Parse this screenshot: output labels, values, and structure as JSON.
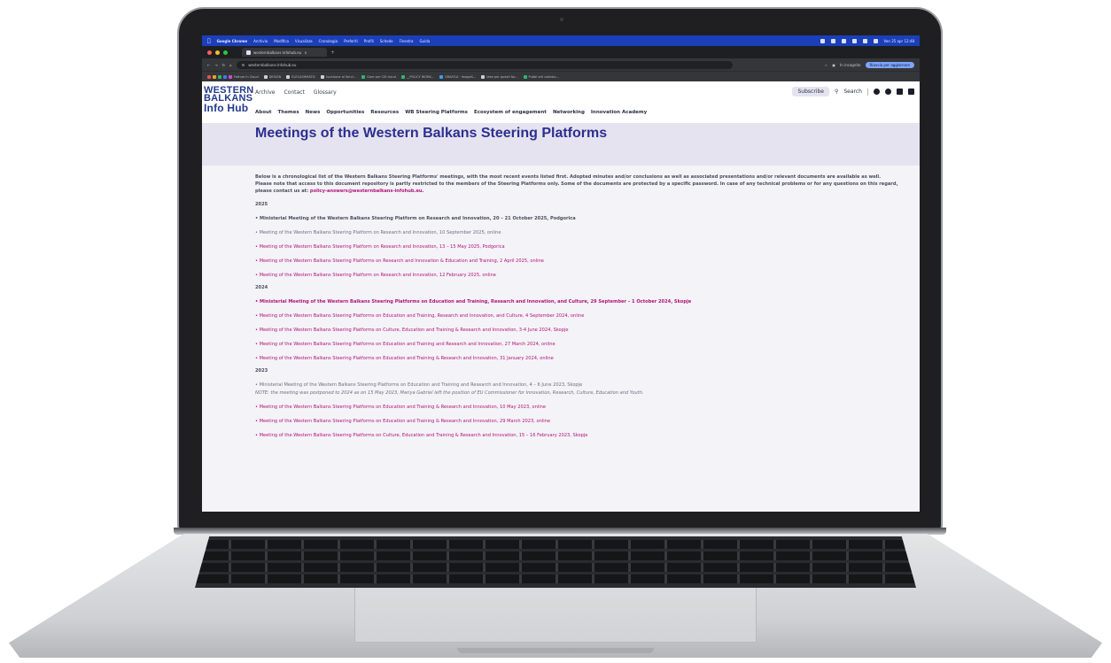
{
  "mac_menubar": {
    "items": [
      "Google Chrome",
      "Archivio",
      "Modifica",
      "Visualizza",
      "Cronologia",
      "Preferiti",
      "Profili",
      "Schede",
      "Finestra",
      "Guida"
    ],
    "clock": "Ven 25 apr 12:48"
  },
  "browser": {
    "tab_title": "westernbalkans-infohub.eu",
    "url": "westernbalkans-infohub.eu",
    "incognito_label": "In incognito",
    "update_button": "Riavvia per aggiornare",
    "bookmarks": [
      "Fatture in Cloud",
      "DESIGN",
      "ELECASHMATIC",
      "Iscrizione al Servi...",
      "Gare per CIS cloud",
      "__POLICY WORK...",
      "GRAFICA · ImageS...",
      "Idee per questi for...",
      "Pubbl orti collezio..."
    ]
  },
  "site": {
    "logo": [
      "WESTERN",
      "BALKANS",
      "Info Hub"
    ],
    "top_nav": [
      "Archive",
      "Contact",
      "Glossary"
    ],
    "main_nav": [
      "About",
      "Themes",
      "News",
      "Opportunities",
      "Resources",
      "WB Steering Platforms",
      "Ecosystem of engagement",
      "Networking",
      "Innovation Academy"
    ],
    "subscribe": "Subscribe",
    "search": "Search"
  },
  "page": {
    "title": "Meetings of the Western Balkans Steering Platforms",
    "intro_1": "Below is a chronological list of the Western Balkans Steering Platforms' meetings, with the most recent events listed first. Adopted minutes and/or conclusions as well as associated presentations and/or relevant documents are available as well.",
    "intro_2": "Please note that access to this document repository is partly restricted to the members of the Steering Platforms only. Some of the documents are protected by a specific password. In case of any technical problems or for any questions on this regard, please contact us at:",
    "contact_email": "policy-answers@westernbalkans-infohub.eu.",
    "y2025": "2025",
    "m2025_1": "• Ministerial Meeting of the Western Balkans Steering Platform on Research and Innovation, 20 – 21 October 2025, Podgorica",
    "m2025_2": "• Meeting of the Western Balkans Steering Platform on Research and Innovation, 10 September 2025, online",
    "m2025_3": "• Meeting of the Western Balkans Steering Platform on Research and Innovation, 13 – 15 May 2025, Podgorica",
    "m2025_4": "• Meeting of the Western Balkans Steering Platforms on Research and Innovation & Education and Training, 2 April 2025, online",
    "m2025_5": "• Meeting of the Western Balkans Steering Platform on Research and Innovation, 12 February 2025, online",
    "y2024": "2024",
    "m2024_1": "• Ministerial Meeting of the Western Balkans Steering Platforms on Education and Training, Research and Innovation, and Culture, 29 September – 1 October 2024, Skopje",
    "m2024_2": "• Meeting of the Western Balkans Steering Platforms on Education and Training, Research and Innovation, and Culture, 4 September 2024, online",
    "m2024_3": "• Meeting of the Western Balkans Steering Platforms on Culture, Education and Training & Research and Innovation, 3-4 June 2024, Skopje",
    "m2024_4": "• Meeting of the Western Balkans Steering Platforms on Education and Training and Research and Innovation, 27 March 2024, online",
    "m2024_5": "• Meeting of the Western Balkans Steering Platforms on Education and Training & Research and Innovation, 31 January 2024, online",
    "y2023": "2023",
    "m2023_1": "• Ministerial Meeting of the Western Balkans Steering Platforms on Education and Training and Research and Innovation, 4 – 6 June 2023, Skopje",
    "m2023_note": "NOTE: the meeting was postponed to 2024 as on 15 May 2023, Mariya Gabriel left the position of EU Commissioner for Innovation, Research, Culture, Education and Youth.",
    "m2023_2": "• Meeting of the Western Balkans Steering Platforms on Education and Training & Research and Innovation, 10 May 2023, online",
    "m2023_3": "• Meeting of the Western Balkans Steering Platforms on Education and Training & Research and Innovation, 29 March 2023, online",
    "m2023_4": "• Meeting of the Western Balkans Steering Platforms on Culture, Education and Training & Research and Innovation, 15 – 16 February 2023, Skopje"
  }
}
